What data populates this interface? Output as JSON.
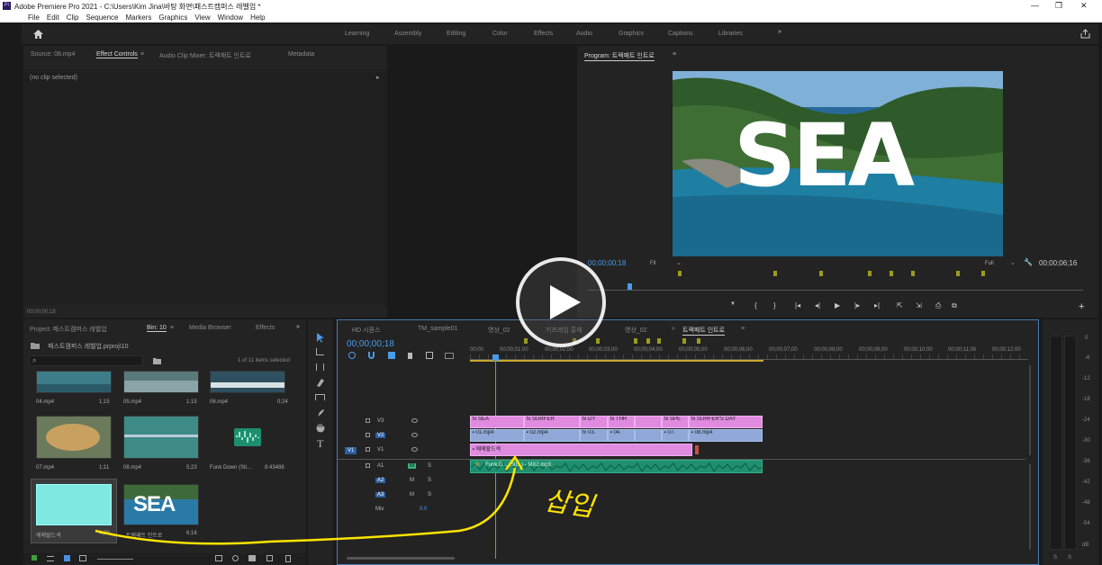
{
  "app": {
    "title": "Adobe Premiere Pro 2021 - C:\\Users\\Kim Jina\\바탕 화면\\패스트캠퍼스 레벨업 *",
    "logo": "Pr"
  },
  "window_controls": [
    "—",
    "❐",
    "✕"
  ],
  "menu": [
    "File",
    "Edit",
    "Clip",
    "Sequence",
    "Markers",
    "Graphics",
    "View",
    "Window",
    "Help"
  ],
  "workspaces": [
    "Learning",
    "Assembly",
    "Editing",
    "Color",
    "Effects",
    "Audio",
    "Graphics",
    "Captions",
    "Libraries",
    "»"
  ],
  "source_panel": {
    "tabs": [
      "Source: 08.mp4",
      "Effect Controls",
      "Audio Clip Mixer: 트랙패트 인트로",
      "Metadata"
    ],
    "active_tab": "Effect Controls",
    "menu_glyph": "≡",
    "no_clip": "(no clip selected)",
    "arrow": "▸",
    "timecode": "00;00;00;18"
  },
  "program_panel": {
    "title": "Program: 트랙패트 인트로",
    "menu_glyph": "≡",
    "overlay_text": "SEA",
    "timecode": "00;00;00;18",
    "fit": "Fit",
    "quality": "Full",
    "duration": "00;00;06;16",
    "dropdown_glyph": "⌄",
    "wrench_glyph": "🔧",
    "transport": [
      "▼",
      "{",
      "}",
      "|◂",
      "◂|",
      "▶",
      "|▸",
      "▸|",
      "⇱",
      "⇲",
      "⎙",
      "⧉"
    ],
    "add_button": "+"
  },
  "project_panel": {
    "tabs": [
      "Project: 패스트캠퍼스 레벨업",
      "Bin: 10",
      "Media Browser",
      "Effects",
      "»"
    ],
    "active_tab": "Bin: 10",
    "menu_glyph": "≡",
    "path": "패스트캠퍼스 레벨업.prproj\\10",
    "count_text": "1 of 11 items selected",
    "search_placeholder": "",
    "search_icon_glyph": "⌕",
    "items": [
      {
        "name": "04.mp4",
        "duration": "1;15"
      },
      {
        "name": "05.mp4",
        "duration": "1;15"
      },
      {
        "name": "06.mp4",
        "duration": "0;24"
      },
      {
        "name": "07.mp4",
        "duration": "1;11"
      },
      {
        "name": "08.mp4",
        "duration": "5;23"
      },
      {
        "name": "Funk Down (Sti...",
        "duration": "8:43488"
      },
      {
        "name": "에메랄드색",
        "duration": "4;29"
      },
      {
        "name": "트랙패트 인트로",
        "duration": "6;16"
      }
    ],
    "sea_thumb_text": "SEA"
  },
  "timeline": {
    "tabs": [
      "HD 시퀀스",
      "TM_sample01",
      "영상_02",
      "키프레임 흥재",
      "영상_02",
      "»",
      "트랙패트 인트로"
    ],
    "active_tab": "트랙패트 인트로",
    "menu_glyph": "≡",
    "timecode": "00;00;00;18",
    "ruler": [
      "00;00",
      "00;00;01;00",
      "00;00;02;00",
      "00;00;03;00",
      "00;00;04;00",
      "00;00;05;00",
      "00;00;06;00",
      "00;00;07;00",
      "00;00;08;00",
      "00;00;09;00",
      "00;00;10;00",
      "00;00;11;00",
      "00;00;12;00"
    ],
    "tracks": [
      "V3",
      "V2",
      "V1",
      "A1",
      "A2",
      "A3",
      "Mix"
    ],
    "source_patch": "V1",
    "mute_label": "M",
    "solo_label": "S",
    "mix_value": "0.0",
    "v3_clips": [
      "SEA",
      "SURFER",
      "DY",
      "THR",
      "SPE",
      "SURFER'S DAY"
    ],
    "v2_clips": [
      "01.mp4",
      "02.mp4",
      "03.",
      "04.",
      "07.",
      "08.mp4"
    ],
    "v1_clip": "에메랄드색",
    "a1_clip": "Funk D... (Sti...) - MX2.mp3",
    "fx_glyph": "fx"
  },
  "annotation": {
    "handwritten": "삽입"
  },
  "meter": {
    "scale": [
      "0",
      "-6",
      "-12",
      "-18",
      "-24",
      "-30",
      "-36",
      "-42",
      "-48",
      "-54",
      "dB"
    ],
    "solo": [
      "S",
      "S"
    ]
  }
}
